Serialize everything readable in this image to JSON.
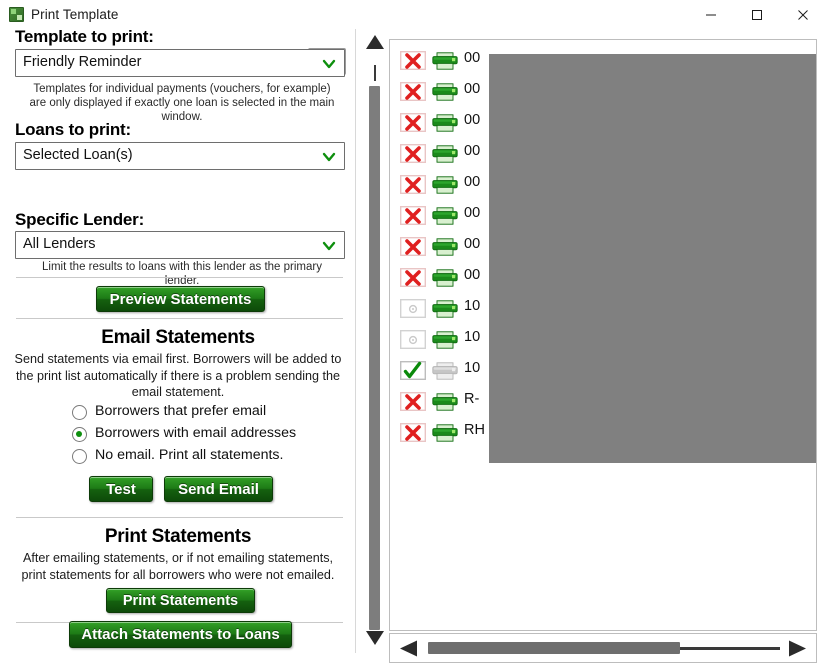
{
  "window": {
    "title": "Print Template",
    "icon": "app-grid-icon",
    "controls": {
      "minimize": "minimize-icon",
      "maximize": "maximize-icon",
      "close": "close-icon"
    }
  },
  "form": {
    "template_label": "Template to print:",
    "template_value": "Friendly Reminder",
    "template_hint": "Templates for individual payments (vouchers, for example) are only displayed if exactly one loan is selected in the main window.",
    "loans_label": "Loans to print:",
    "loans_value": "Selected Loan(s)",
    "lender_label": "Specific Lender:",
    "lender_value": "All Lenders",
    "lender_hint": "Limit the results to loans with this lender as the primary lender.",
    "preview_button": "Preview Statements",
    "help_button_icon": "info-badge-icon"
  },
  "email_section": {
    "title": "Email Statements",
    "description": "Send statements via email first.  Borrowers will be added to the print list automatically if there is a problem sending the email statement.",
    "options": [
      {
        "label": "Borrowers that prefer email",
        "selected": false
      },
      {
        "label": "Borrowers with email addresses",
        "selected": true
      },
      {
        "label": "No email. Print all statements.",
        "selected": false
      }
    ],
    "test_button": "Test",
    "send_button": "Send Email"
  },
  "print_section": {
    "title": "Print Statements",
    "description": "After emailing statements, or if not emailing statements, print statements for all borrowers who were not emailed.",
    "print_button": "Print Statements",
    "attach_button": "Attach Statements to Loans"
  },
  "list_panel": {
    "redacted": true,
    "rows": [
      {
        "email_icon": "envelope-x-icon",
        "email_state": "error",
        "print_icon": "printer-icon",
        "print_state": "active",
        "text": "00"
      },
      {
        "email_icon": "envelope-x-icon",
        "email_state": "error",
        "print_icon": "printer-icon",
        "print_state": "active",
        "text": "00"
      },
      {
        "email_icon": "envelope-x-icon",
        "email_state": "error",
        "print_icon": "printer-icon",
        "print_state": "active",
        "text": "00"
      },
      {
        "email_icon": "envelope-x-icon",
        "email_state": "error",
        "print_icon": "printer-icon",
        "print_state": "active",
        "text": "00"
      },
      {
        "email_icon": "envelope-x-icon",
        "email_state": "error",
        "print_icon": "printer-icon",
        "print_state": "active",
        "text": "00"
      },
      {
        "email_icon": "envelope-x-icon",
        "email_state": "error",
        "print_icon": "printer-icon",
        "print_state": "active",
        "text": "00"
      },
      {
        "email_icon": "envelope-x-icon",
        "email_state": "error",
        "print_icon": "printer-icon",
        "print_state": "active",
        "text": "00"
      },
      {
        "email_icon": "envelope-x-icon",
        "email_state": "error",
        "print_icon": "printer-icon",
        "print_state": "active",
        "text": "00"
      },
      {
        "email_icon": "envelope-blank-icon",
        "email_state": "disabled",
        "print_icon": "printer-icon",
        "print_state": "active",
        "text": "10"
      },
      {
        "email_icon": "envelope-blank-icon",
        "email_state": "disabled",
        "print_icon": "printer-icon",
        "print_state": "active",
        "text": "10"
      },
      {
        "email_icon": "envelope-check-icon",
        "email_state": "sent",
        "print_icon": "printer-icon",
        "print_state": "disabled",
        "text": "10"
      },
      {
        "email_icon": "envelope-x-icon",
        "email_state": "error",
        "print_icon": "printer-icon",
        "print_state": "active",
        "text": "R-"
      },
      {
        "email_icon": "envelope-x-icon",
        "email_state": "error",
        "print_icon": "printer-icon",
        "print_state": "active",
        "text": "RH"
      }
    ],
    "vertical_scrollbar": {
      "up_arrow": "triangle-up-icon",
      "down_arrow": "triangle-down-icon"
    },
    "horizontal_scrollbar": {
      "left_arrow": "triangle-left-icon",
      "right_arrow": "triangle-right-icon"
    }
  },
  "colors": {
    "button_green_light": "#35a72a",
    "button_green_dark": "#0d4a09",
    "error_red": "#e02020",
    "printer_green": "#1f8a1f",
    "redaction_gray": "#808080"
  }
}
